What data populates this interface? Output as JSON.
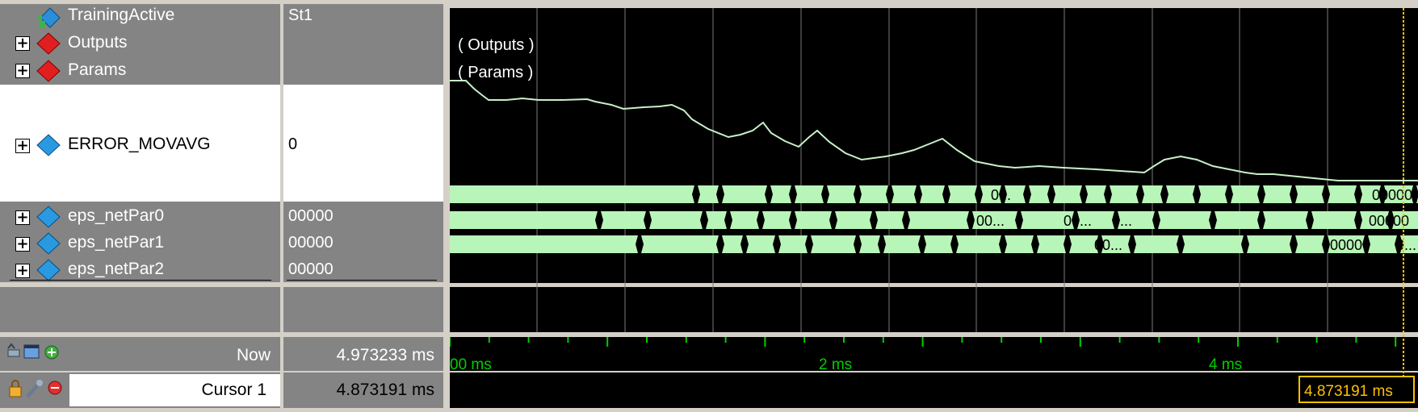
{
  "signals": [
    {
      "name": "TrainingActive",
      "value": "St1",
      "expandable": false,
      "icon": "logic-signal-icon"
    },
    {
      "name": "Outputs",
      "value": "",
      "expandable": true,
      "icon": "group-diamond-red-icon"
    },
    {
      "name": "Params",
      "value": "",
      "expandable": true,
      "icon": "group-diamond-red-icon"
    },
    {
      "name": "ERROR_MOVAVG",
      "value": "0",
      "expandable": true,
      "icon": "signal-diamond-blue-icon"
    },
    {
      "name": "eps_netPar0",
      "value": "00000",
      "expandable": true,
      "icon": "signal-diamond-blue-icon"
    },
    {
      "name": "eps_netPar1",
      "value": "00000",
      "expandable": true,
      "icon": "signal-diamond-blue-icon"
    },
    {
      "name": "eps_netPar2",
      "value": "00000",
      "expandable": true,
      "icon": "signal-diamond-blue-icon"
    }
  ],
  "waves": {
    "outputs_label": "( Outputs )",
    "params_label": "( Params )",
    "bus0_labels": [
      "0...",
      "00000"
    ],
    "bus1_labels": [
      "00...",
      "00...",
      "0...",
      "00000"
    ],
    "bus2_labels": [
      "00...",
      "00000",
      "0..."
    ]
  },
  "footer": {
    "now_label": "Now",
    "now_value": "4.973233 ms",
    "cursor_label": "Cursor 1",
    "cursor_value": "4.873191 ms",
    "cursor_marker": "4.873191 ms",
    "timeline_ticks": [
      "00 ms",
      "2 ms",
      "4 ms"
    ]
  },
  "colors": {
    "wave_bg": "#000000",
    "bus_fill": "#b8f5b8",
    "analog_line": "#c8f0c8",
    "timeline_green": "#00d000",
    "cursor_yellow": "#ffc000",
    "grid": "#7a7a7a"
  }
}
